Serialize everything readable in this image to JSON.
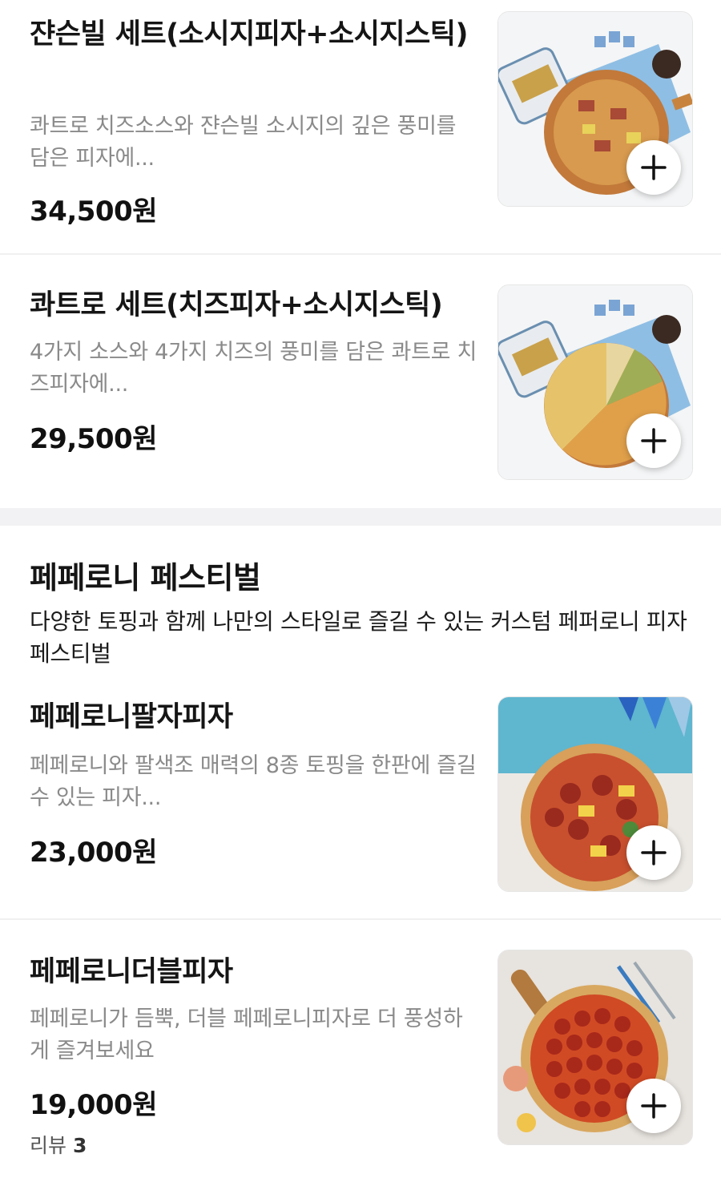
{
  "items": [
    {
      "title": "쟌슨빌 세트(소시지피자+소시지스틱)",
      "description": "콰트로 치즈소스와 쟌슨빌 소시지의 깊은 풍미를 담은 피자에...",
      "price": "34,500원"
    },
    {
      "title": "콰트로 세트(치즈피자+소시지스틱)",
      "description": "4가지 소스와 4가지 치즈의 풍미를 담은 콰트로 치즈피자에...",
      "price": "29,500원"
    }
  ],
  "section": {
    "title": "페페로니 페스티벌",
    "description": "다양한 토핑과 함께 나만의 스타일로 즐길 수 있는 커스텀 페퍼로니 피자 페스티벌",
    "items": [
      {
        "title": "페페로니팔자피자",
        "description": "페페로니와 팔색조 매력의 8종 토핑을 한판에 즐길 수 있는 피자...",
        "price": "23,000원"
      },
      {
        "title": "페페로니더블피자",
        "description": "페페로니가 듬뿍, 더블 페페로니피자로 더 풍성하게 즐겨보세요",
        "price": "19,000원",
        "review_label": "리뷰",
        "review_count": "3"
      }
    ]
  },
  "icons": {
    "add": "plus-icon"
  },
  "colors": {
    "section_gap": "#f2f2f4",
    "price": "#111111",
    "description": "#8a8a8a"
  }
}
